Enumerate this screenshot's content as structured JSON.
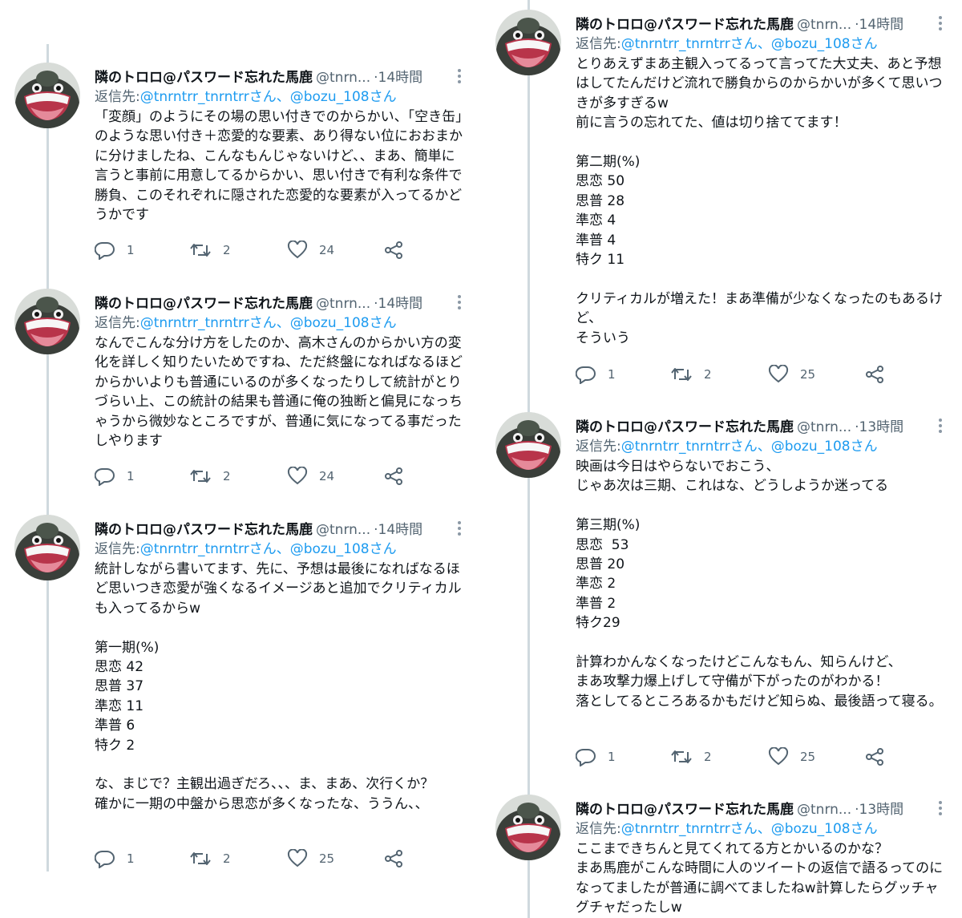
{
  "user": {
    "name": "隣のトロロ@パスワード忘れた馬鹿",
    "handle": "@tnrn...",
    "reply_label": "返信先:",
    "reply_user1": "@tnrntrr_tnrntrrさん",
    "reply_sep": "、",
    "reply_user2": "@bozu_108さん"
  },
  "tweets": [
    {
      "time": "14時間",
      "body": "「変顔」のようにその場の思い付きでのからかい、「空き缶」のような思い付き＋恋愛的な要素、あり得ない位におおまかに分けましたね、こんなもんじゃないけど、、まあ、簡単に言うと事前に用意してるからかい、思い付きで有利な条件で勝負、このそれぞれに隠された恋愛的な要素が入ってるかどうかです",
      "replies": "1",
      "retweets": "2",
      "likes": "24"
    },
    {
      "time": "14時間",
      "body": "なんでこんな分け方をしたのか、高木さんのからかい方の変化を詳しく知りたいためですね、ただ終盤になればなるほどからかいよりも普通にいるのが多くなったりして統計がとりづらい上、この統計の結果も普通に俺の独断と偏見になっちゃうから微妙なところですが、普通に気になってる事だったしやります",
      "replies": "1",
      "retweets": "2",
      "likes": "24"
    },
    {
      "time": "14時間",
      "body": "統計しながら書いてます、先に、予想は最後になればなるほど思いつき恋愛が強くなるイメージあと追加でクリティカルも入ってるからw\n\n第一期(%)\n思恋 42\n思普 37\n準恋 11\n準普 6\n特ク 2\n\nな、まじで？主観出過ぎだろ、、、ま、まあ、次行くか？\n確かに一期の中盤から思恋が多くなったな、ううん、、",
      "replies": "1",
      "retweets": "2",
      "likes": "25"
    },
    {
      "time": "14時間",
      "body": "とりあえずまあ主観入ってるって言ってた大丈夫、あと予想はしてたんだけど流れで勝負からのからかいが多くて思いつきが多すぎるw\n前に言うの忘れてた、値は切り捨ててます！\n\n第二期(%)\n思恋 50\n思普 28\n準恋 4\n準普 4\n特ク 11\n\nクリティカルが増えた！まあ準備が少なくなったのもあるけど、\nそういう",
      "replies": "1",
      "retweets": "2",
      "likes": "25"
    },
    {
      "time": "13時間",
      "body": "映画は今日はやらないでおこう、\nじゃあ次は三期、これはな、どうしようか迷ってる\n\n第三期(%)\n思恋  53\n思普 20\n準恋 2\n準普 2\n特ク29\n\n計算わかんなくなったけどこんなもん、知らんけど、\nまあ攻撃力爆上げして守備が下がったのがわかる！\n落としてるところあるかもだけど知らぬ、最後語って寝る。",
      "replies": "1",
      "retweets": "2",
      "likes": "25"
    },
    {
      "time": "13時間",
      "body": "ここまできちんと見てくれてる方とかいるのかな？\nまあ馬鹿がこんな時間に人のツイートの返信で語るってのになってましたが普通に調べてましたねw計算したらグッチャグチャだったしw",
      "replies": "",
      "retweets": "",
      "likes": ""
    }
  ]
}
